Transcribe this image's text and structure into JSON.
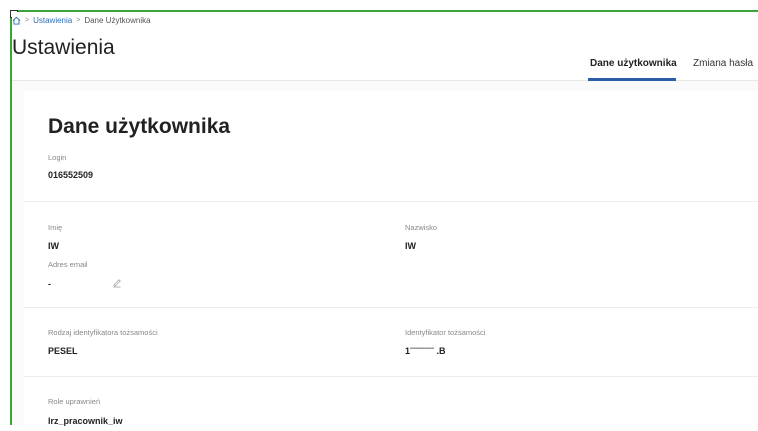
{
  "breadcrumb": {
    "home_icon": "home-icon",
    "items": [
      "Ustawienia",
      "Dane Użytkownika"
    ],
    "separator": ">"
  },
  "page": {
    "title": "Ustawienia"
  },
  "tabs": [
    {
      "label": "Dane użytkownika",
      "active": true
    },
    {
      "label": "Zmiana hasła",
      "active": false
    }
  ],
  "section": {
    "title": "Dane użytkownika",
    "login_label": "Login",
    "login_value": "016552509",
    "first_name_label": "Imię",
    "first_name_value": "IW",
    "last_name_label": "Nazwisko",
    "last_name_value": "IW",
    "email_label": "Adres email",
    "email_value": "-",
    "id_type_label": "Rodzaj identyfikatora tożsamości",
    "id_type_value": "PESEL",
    "id_label": "Identyfikator tożsamości",
    "id_value": "1ˉˉˉˉˉˉˉˉ .B",
    "roles_label": "Role uprawnień",
    "roles_value": "lrz_pracownik_iw"
  },
  "colors": {
    "accent": "#2a5fa8",
    "link": "#2f6fb3",
    "frame": "#3aa63a"
  }
}
